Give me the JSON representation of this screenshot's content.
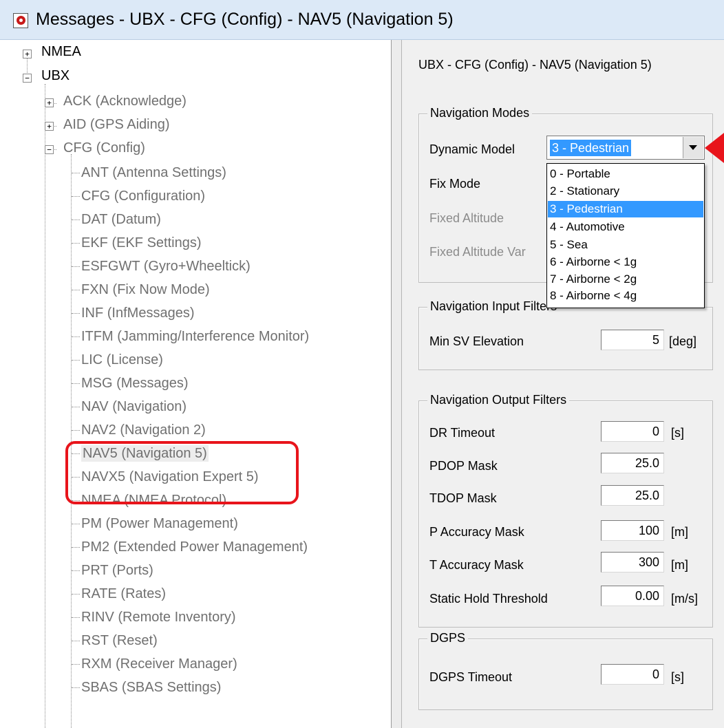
{
  "window": {
    "title": "Messages - UBX - CFG (Config) - NAV5 (Navigation 5)",
    "accent": "#dce9f7",
    "icon": "app-record-icon"
  },
  "tree": {
    "nmea": "NMEA",
    "ubx": "UBX",
    "ack": "ACK (Acknowledge)",
    "aid": "AID (GPS Aiding)",
    "cfg": "CFG (Config)",
    "cfg_items": [
      "ANT (Antenna Settings)",
      "CFG (Configuration)",
      "DAT (Datum)",
      "EKF (EKF Settings)",
      "ESFGWT (Gyro+Wheeltick)",
      "FXN (Fix Now Mode)",
      "INF (InfMessages)",
      "ITFM (Jamming/Interference Monitor)",
      "LIC (License)",
      "MSG (Messages)",
      "NAV (Navigation)",
      "NAV2 (Navigation 2)",
      "NAV5 (Navigation 5)",
      "NAVX5 (Navigation Expert 5)",
      "NMEA (NMEA Protocol)",
      "PM (Power Management)",
      "PM2 (Extended Power Management)",
      "PRT (Ports)",
      "RATE (Rates)",
      "RINV (Remote Inventory)",
      "RST (Reset)",
      "RXM (Receiver Manager)",
      "SBAS (SBAS Settings)"
    ],
    "selected_item": "NAV5 (Navigation 5)",
    "expander_collapsed": "+",
    "expander_expanded": "−"
  },
  "form": {
    "header": "UBX - CFG (Config) - NAV5 (Navigation 5)",
    "navigation_modes": {
      "title": "Navigation Modes",
      "dynamic_model_label": "Dynamic Model",
      "dynamic_model_value": "3 - Pedestrian",
      "fix_mode_label": "Fix Mode",
      "fixed_altitude_label": "Fixed Altitude",
      "fixed_altitude_var_label": "Fixed Altitude Var"
    },
    "dropdown_options": [
      "0 - Portable",
      "2 - Stationary",
      "3 - Pedestrian",
      "4 - Automotive",
      "5 - Sea",
      "6 - Airborne < 1g",
      "7 - Airborne < 2g",
      "8 - Airborne < 4g"
    ],
    "input_filters": {
      "title": "Navigation Input Filters",
      "min_sv_label": "Min SV Elevation",
      "min_sv_value": "5",
      "min_sv_unit": "[deg]"
    },
    "output_filters": {
      "title": "Navigation Output Filters",
      "dr_timeout_label": "DR Timeout",
      "dr_timeout_value": "0",
      "dr_timeout_unit": "[s]",
      "pdop_label": "PDOP Mask",
      "pdop_value": "25.0",
      "tdop_label": "TDOP Mask",
      "tdop_value": "25.0",
      "pacc_label": "P Accuracy Mask",
      "pacc_value": "100",
      "pacc_unit": "[m]",
      "tacc_label": "T Accuracy Mask",
      "tacc_value": "300",
      "tacc_unit": "[m]",
      "static_label": "Static Hold Threshold",
      "static_value": "0.00",
      "static_unit": "[m/s]"
    },
    "dgps": {
      "title": "DGPS",
      "timeout_label": "DGPS Timeout",
      "timeout_value": "0",
      "timeout_unit": "[s]"
    }
  },
  "annotations": {
    "highlight_color": "#e8141b",
    "arrow_color": "#e8141b"
  }
}
